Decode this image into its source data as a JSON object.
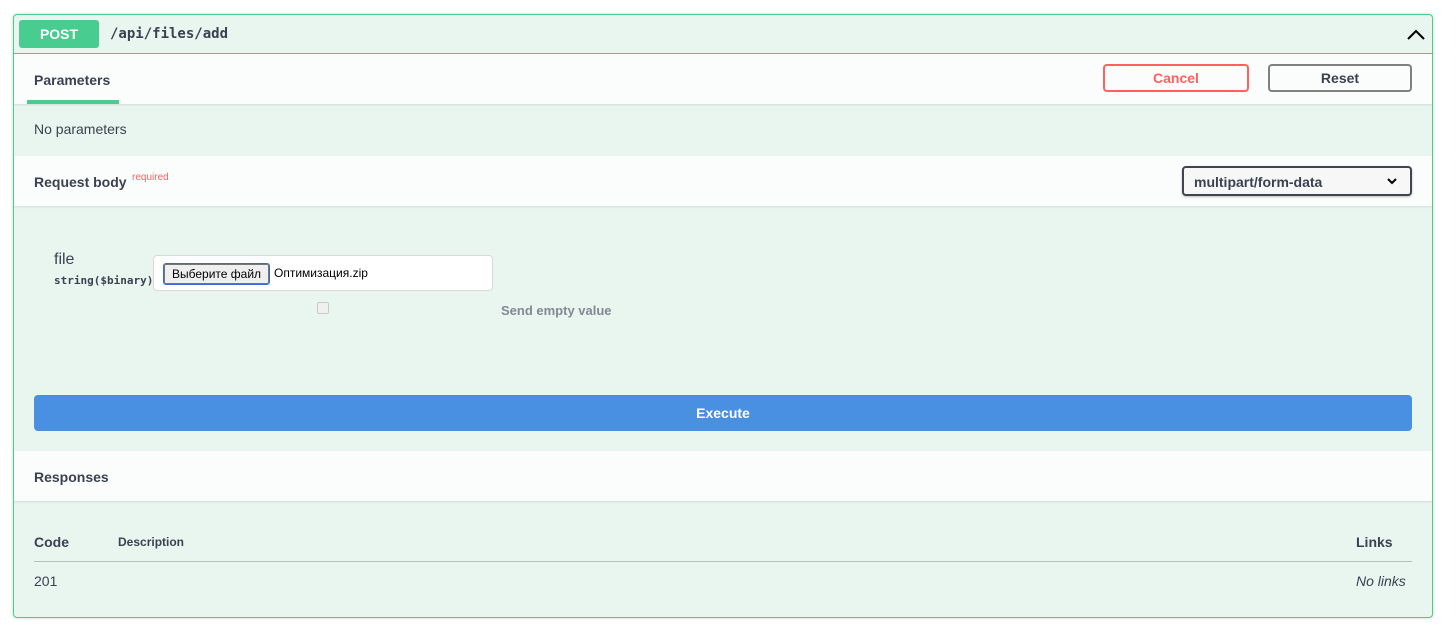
{
  "operation": {
    "method": "POST",
    "path": "/api/files/add"
  },
  "parameters": {
    "tab_label": "Parameters",
    "cancel_label": "Cancel",
    "reset_label": "Reset",
    "empty_text": "No parameters"
  },
  "request_body": {
    "title": "Request body",
    "required_label": "required",
    "content_type": "multipart/form-data",
    "field": {
      "name": "file",
      "type": "string($binary)",
      "choose_button": "Выберите файл",
      "file_name": "Оптимизация.zip",
      "send_empty_label": "Send empty value",
      "send_empty_checked": false
    }
  },
  "execute_label": "Execute",
  "responses": {
    "title": "Responses",
    "columns": {
      "code": "Code",
      "description": "Description",
      "links": "Links"
    },
    "rows": [
      {
        "code": "201",
        "description": "",
        "links": "No links"
      }
    ]
  },
  "colors": {
    "post_green": "#49cc90",
    "block_background": "#e8f6ef",
    "execute_blue": "#4990e2",
    "cancel_red": "#ff6060"
  },
  "icons": {
    "collapse": "chevron-up-icon",
    "select": "chevron-down-icon"
  }
}
